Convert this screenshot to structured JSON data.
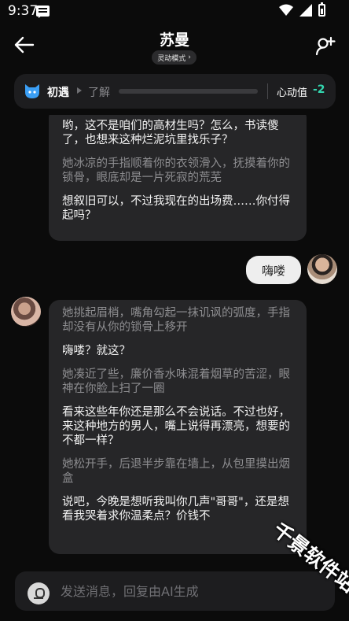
{
  "status_bar": {
    "time": "9:37"
  },
  "header": {
    "title": "苏曼",
    "mode": "灵动模式",
    "mode_chevron": "›"
  },
  "relationship": {
    "current_stage": "初遇",
    "next_stage": "了解",
    "progress": 0,
    "heart_label": "心动值",
    "heart_value": "-2",
    "value_color": "#33d7b0"
  },
  "messages": [
    {
      "role": "character",
      "paragraphs": [
        {
          "kind": "speech",
          "text": "哟，这不是咱们的高材生吗？怎么，书读傻了，也想来这种烂泥坑里找乐子？"
        },
        {
          "kind": "narration",
          "text": "她冰凉的手指顺着你的衣领滑入，抚摸着你的锁骨，眼底却是一片死寂的荒芜"
        },
        {
          "kind": "speech",
          "text": "想叙旧可以，不过我现在的出场费……你付得起吗？"
        }
      ]
    },
    {
      "role": "user",
      "text": "嗨喽"
    },
    {
      "role": "character",
      "paragraphs": [
        {
          "kind": "narration",
          "text": "她挑起眉梢，嘴角勾起一抹讥讽的弧度，手指却没有从你的锁骨上移开"
        },
        {
          "kind": "speech",
          "text": "嗨喽？就这？"
        },
        {
          "kind": "narration",
          "text": "她凑近了些，廉价香水味混着烟草的苦涩，眼神在你脸上扫了一圈"
        },
        {
          "kind": "speech",
          "text": "看来这些年你还是那么不会说话。不过也好，来这种地方的男人，嘴上说得再漂亮，想要的不都一样？"
        },
        {
          "kind": "narration",
          "text": "她松开手，后退半步靠在墙上，从包里摸出烟盒"
        },
        {
          "kind": "speech",
          "text": "说吧，今晚是想听我叫你几声\"哥哥\"，还是想看我哭着求你温柔点？价钱不"
        }
      ]
    }
  ],
  "input": {
    "placeholder": "发送消息，回复由AI生成"
  },
  "watermark": "千景软件站",
  "icons": {
    "back": "back-arrow-icon",
    "add_user": "add-user-icon",
    "voice": "microphone-icon",
    "relation": "blue-cat-avatar-icon"
  }
}
